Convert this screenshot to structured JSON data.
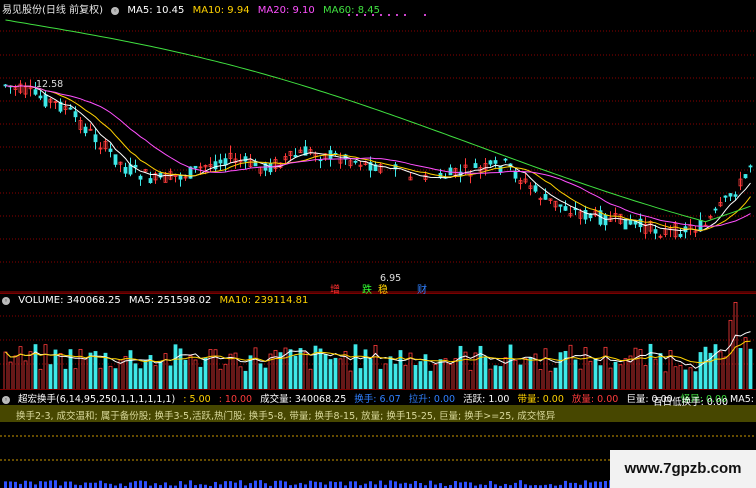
{
  "price_header": {
    "stock_name": "易见股份(日线 前复权)",
    "ma5_label": "MA5: 10.45",
    "ma10_label": "MA10: 9.94",
    "ma20_label": "MA20: 9.10",
    "ma60_label": "MA60: 8.45"
  },
  "price_labels": {
    "high": "12.58",
    "low": "6.95"
  },
  "markers": [
    {
      "text": "增",
      "color": "#ff3030"
    },
    {
      "text": "跌",
      "color": "#30ff30"
    },
    {
      "text": "稳",
      "color": "#ffd200"
    },
    {
      "text": "财",
      "color": "#3080ff"
    }
  ],
  "volume_header": {
    "label": "VOLUME: 340068.25",
    "ma5_label": "MA5: 251598.02",
    "ma10_label": "MA10: 239114.81"
  },
  "indicator_header": {
    "name": "超宏换手(6,14,95,250,1,1,1,1,1,1)",
    "v1": ": 5.00",
    "v2": ": 10.00",
    "volume_text": "成交量: 340068.25",
    "turnover": "换手: 6.07",
    "rise": "拉升: 0.00",
    "active": "活跃: 1.00",
    "with_volume": "带量: 0.00",
    "upscale": "放量: 0.00",
    "huge": "巨量: 0.00",
    "odd": "怪异: 0.00",
    "hundred_day_low": "百日低换手: 0.00",
    "ma5_tail": "MA5:"
  },
  "legend": {
    "text": "换手2-3, 成交温和; 属于备份股; 换手3-5,活跃,热门股; 换手5-8, 带量; 换手8-15, 放量; 换手15-25, 巨量; 换手>=25, 成交怪异"
  },
  "watermark": {
    "text": "www.7gpzb.com"
  },
  "colors": {
    "up": "#ff3b3b",
    "down": "#3ee8e8",
    "ma5": "#ffffff",
    "ma10": "#ffd200",
    "ma20": "#ff50ff",
    "ma60": "#40e040",
    "grid": "#8a0000",
    "legend_bg": "#474700"
  }
}
